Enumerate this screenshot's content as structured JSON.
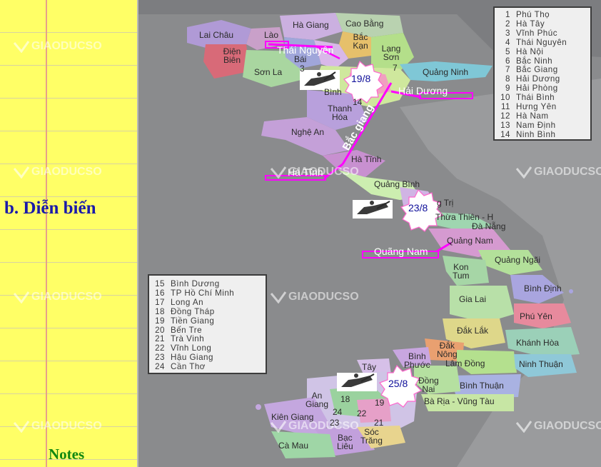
{
  "notes_panel": {
    "section_title": "b. Diễn biến",
    "footer_label": "Notes"
  },
  "watermark": "GIAODUCSO",
  "legend_north": [
    {
      "num": "1",
      "name": "Phú Thọ"
    },
    {
      "num": "2",
      "name": "Hà Tây"
    },
    {
      "num": "3",
      "name": "Vĩnh Phúc"
    },
    {
      "num": "4",
      "name": "Thái Nguyên"
    },
    {
      "num": "5",
      "name": "Hà Nội"
    },
    {
      "num": "6",
      "name": "Bắc Ninh"
    },
    {
      "num": "7",
      "name": "Bắc Giang"
    },
    {
      "num": "8",
      "name": "Hải Dương"
    },
    {
      "num": "9",
      "name": "Hải Phòng"
    },
    {
      "num": "10",
      "name": "Thái Bình"
    },
    {
      "num": "11",
      "name": "Hưng Yên"
    },
    {
      "num": "12",
      "name": "Hà Nam"
    },
    {
      "num": "13",
      "name": "Nam Định"
    },
    {
      "num": "14",
      "name": "Ninh Bình"
    }
  ],
  "legend_south": [
    {
      "num": "15",
      "name": "Bình Dương"
    },
    {
      "num": "16",
      "name": "TP Hồ Chí Minh"
    },
    {
      "num": "17",
      "name": "Long An"
    },
    {
      "num": "18",
      "name": "Đồng Tháp"
    },
    {
      "num": "19",
      "name": "Tiền Giang"
    },
    {
      "num": "20",
      "name": "Bến Tre"
    },
    {
      "num": "21",
      "name": "Trà Vinh"
    },
    {
      "num": "22",
      "name": "Vĩnh Long"
    },
    {
      "num": "23",
      "name": "Hậu Giang"
    },
    {
      "num": "24",
      "name": "Cần Thơ"
    }
  ],
  "map_labels": {
    "lai_chau": "Lai Châu",
    "lao_cai": "Lào",
    "ha_giang": "Hà Giang",
    "cao_bang": "Cao Bằng",
    "bac_kan": "Bắc Kạn",
    "dien_bien": "Điện Biên",
    "son_la": "Sơn La",
    "lang_son": "Lạng Sơn",
    "yen_bai": "Bái",
    "quang_ninh": "Quảng Ninh",
    "ninh_binh": "Bình",
    "thanh_hoa": "Thanh Hóa",
    "nghe_an": "Nghệ An",
    "ha_tinh": "Hà Tĩnh",
    "quang_binh": "Quảng Bình",
    "quang_tri": "g Trị",
    "hue": "Thừa Thiên - H",
    "da_nang": "Đà Nẵng",
    "quang_nam": "Quảng Nam",
    "quang_ngai": "Quảng Ngãi",
    "kon_tum_1": "Kon",
    "kon_tum_2": "Tum",
    "binh_dinh": "Bình Định",
    "gia_lai": "Gia Lai",
    "phu_yen": "Phú Yên",
    "dak_lak": "Đắk Lắk",
    "khanh_hoa": "Khánh Hòa",
    "dak_nong_1": "Đắk",
    "dak_nong_2": "Nông",
    "lam_dong": "Lâm Đồng",
    "ninh_thuan": "Ninh Thuận",
    "binh_thuan": "Bình Thuận",
    "binh_phuoc_1": "Bình",
    "binh_phuoc_2": "Phước",
    "tay_ninh": "Tây",
    "dong_nai_1": "Đồng",
    "dong_nai_2": "Nai",
    "ba_ria": "Bà Rịa - Vũng Tàu",
    "an_giang_1": "An",
    "an_giang_2": "Giang",
    "kien_giang": "Kiên Giang",
    "bac_lieu_1": "Bạc",
    "bac_lieu_2": "Liêu",
    "soc_trang_1": "Sóc",
    "soc_trang_2": "Trăng",
    "ca_mau": "Cà Mau",
    "n3": "3",
    "n7": "7",
    "n14": "14",
    "n18": "18",
    "n19": "19",
    "n22": "22",
    "n23": "23",
    "n24": "24",
    "n21": "21"
  },
  "overlays": {
    "thai_nguyen": "Thái Nguyên",
    "hai_duong": "Hải Dương",
    "bac_giang": "Bắc giang",
    "ha_tinh": "Hà Tĩnh",
    "quang_nam": "Quãng Nam",
    "date_1": "19/8",
    "date_2": "23/8",
    "date_3": "25/8"
  },
  "colors": {
    "highlight": "#ff00ff",
    "legend_border": "#3c3c3c",
    "title": "#1a1aaa",
    "notes": "#118811",
    "panel": "#ffff66"
  }
}
